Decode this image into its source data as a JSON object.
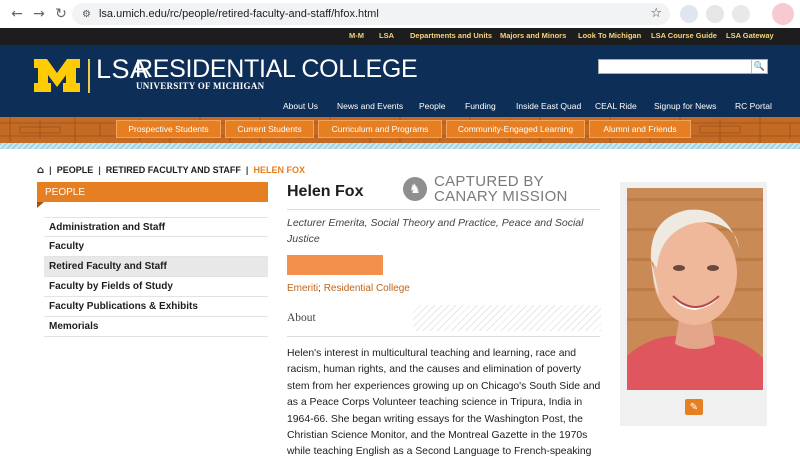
{
  "browser": {
    "url": "lsa.umich.edu/rc/people/retired-faculty-and-staff/hfox.html",
    "back_icon": "←",
    "forward_icon": "→",
    "reload_icon": "↻",
    "star_icon": "☆"
  },
  "utility_nav": [
    "M-M",
    "LSA",
    "Departments and Units",
    "Majors and Minors",
    "Look To Michigan",
    "LSA Course Guide",
    "LSA Gateway"
  ],
  "header": {
    "brand_lsa": "LSA",
    "brand_rc": "RESIDENTIAL COLLEGE",
    "brand_um": "UNIVERSITY OF MICHIGAN",
    "search_placeholder": "",
    "search_icon": "🔍"
  },
  "main_nav": [
    "About Us",
    "News and Events",
    "People",
    "Funding",
    "Inside East Quad",
    "CEAL Ride",
    "Signup for News",
    "RC Portal"
  ],
  "sub_nav": [
    "Prospective Students",
    "Current Students",
    "Curriculum and Programs",
    "Community-Engaged Learning",
    "Alumni and Friends"
  ],
  "breadcrumb": {
    "home_icon": "⌂",
    "items": [
      "PEOPLE",
      "RETIRED FACULTY AND STAFF"
    ],
    "current": "HELEN FOX"
  },
  "sidebar": {
    "heading": "PEOPLE",
    "items": [
      {
        "label": "Administration and Staff",
        "active": false
      },
      {
        "label": "Faculty",
        "active": false
      },
      {
        "label": "Retired Faculty and Staff",
        "active": true
      },
      {
        "label": "Faculty by Fields of Study",
        "active": false
      },
      {
        "label": "Faculty Publications & Exhibits",
        "active": false
      },
      {
        "label": "Memorials",
        "active": false
      }
    ]
  },
  "profile": {
    "name": "Helen Fox",
    "canary_line1": "CAPTURED BY",
    "canary_line2": "CANARY MISSION",
    "title": "Lecturer Emerita, Social Theory and Practice, Peace and Social Justice",
    "meta_1": "Emeriti",
    "meta_sep": ";",
    "meta_2": "Residential College",
    "about_heading": "About",
    "bio": "Helen's interest in multicultural teaching and learning, race and racism, human rights, and the causes and elimination of poverty stem from her experiences growing up on Chicago's South Side and as a Peace Corps Volunteer teaching science in Tripura, India in 1964-66. She began writing essays for the Washington Post, the Christian Science Monitor, and the Montreal Gazette in the 1970s while teaching English as a Second Language to French-speaking",
    "edit_icon": "✎"
  },
  "colors": {
    "header_blue": "#0d2e57",
    "accent_orange": "#e67e22",
    "maize": "#ffcb05"
  }
}
